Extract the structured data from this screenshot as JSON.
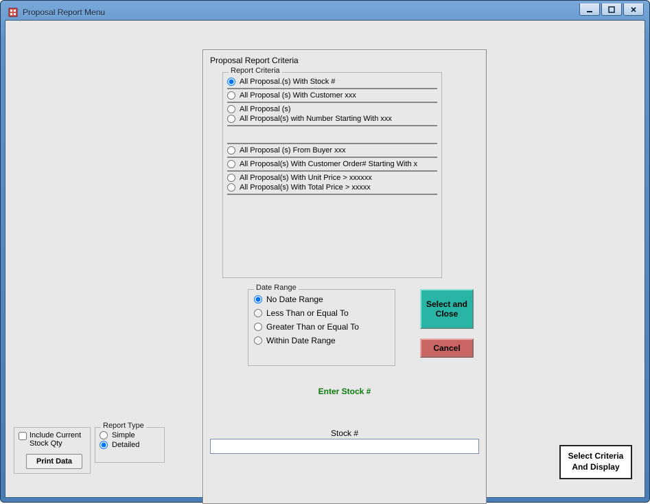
{
  "window": {
    "title": "Proposal Report Menu"
  },
  "dialog": {
    "title": "Proposal Report Criteria",
    "criteria": {
      "legend": "Report Criteria",
      "options": [
        "All Proposal.(s) With Stock #",
        "All Proposal (s) With Customer xxx",
        "All Proposal (s)",
        "All Proposal(s) with Number Starting With xxx",
        "All Proposal (s) From Buyer xxx",
        "All Proposal(s) With Customer Order# Starting With x",
        "All Proposal(s) With Unit Price > xxxxxx",
        "All Proposal(s) With Total Price > xxxxx"
      ],
      "selected_index": 0
    },
    "date_range": {
      "legend": "Date Range",
      "options": [
        "No Date Range",
        "Less Than or Equal To",
        "Greater Than or Equal To",
        "Within Date Range"
      ],
      "selected_index": 0
    },
    "select_close_label": "Select and Close",
    "cancel_label": "Cancel",
    "enter_stock_label": "Enter Stock #",
    "stock_field_label": "Stock #",
    "stock_value": ""
  },
  "include_current": {
    "label": "Include Current Stock Qty",
    "checked": false,
    "print_label": "Print Data"
  },
  "report_type": {
    "legend": "Report Type",
    "options": [
      "Simple",
      "Detailed"
    ],
    "selected_index": 1
  },
  "select_display_label": "Select Criteria And Display"
}
